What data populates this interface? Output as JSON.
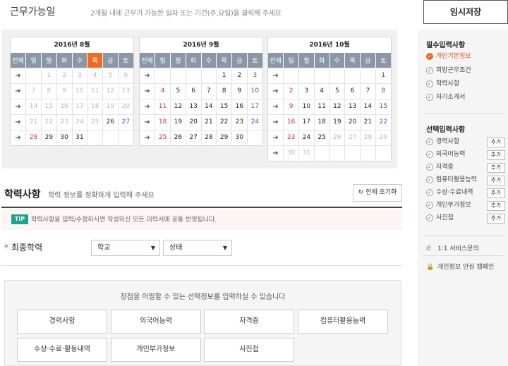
{
  "work_days": {
    "title": "근무가능일",
    "guide": "2개월 내에 근무가 가능한 일자 또는 기간(주,요일)을 클릭해 주세요"
  },
  "calendar": {
    "week_col": "전체",
    "weekdays": [
      "일",
      "월",
      "화",
      "수",
      "목",
      "금",
      "토"
    ],
    "months": [
      {
        "title": "2016년 8월",
        "rows": [
          [
            "",
            "1",
            "2",
            "3",
            "4",
            "5",
            "6"
          ],
          [
            "7",
            "8",
            "9",
            "10",
            "11",
            "12",
            "13"
          ],
          [
            "14",
            "15",
            "16",
            "17",
            "18",
            "19",
            "20"
          ],
          [
            "21",
            "22",
            "23",
            "24",
            "25",
            "26",
            "27"
          ],
          [
            "28",
            "29",
            "30",
            "31",
            "",
            "",
            ""
          ]
        ]
      },
      {
        "title": "2016년 9월",
        "rows": [
          [
            "",
            "",
            "",
            "",
            "1",
            "2",
            "3"
          ],
          [
            "4",
            "5",
            "6",
            "7",
            "8",
            "9",
            "10"
          ],
          [
            "11",
            "12",
            "13",
            "14",
            "15",
            "16",
            "17"
          ],
          [
            "18",
            "19",
            "20",
            "21",
            "22",
            "23",
            "24"
          ],
          [
            "25",
            "26",
            "27",
            "28",
            "29",
            "30",
            ""
          ]
        ]
      },
      {
        "title": "2016년 10월",
        "rows": [
          [
            "",
            "",
            "",
            "",
            "",
            "",
            "1"
          ],
          [
            "2",
            "3",
            "4",
            "5",
            "6",
            "7",
            "8"
          ],
          [
            "9",
            "10",
            "11",
            "12",
            "13",
            "14",
            "15"
          ],
          [
            "16",
            "17",
            "18",
            "19",
            "20",
            "21",
            "22"
          ],
          [
            "23",
            "24",
            "25",
            "26",
            "27",
            "28",
            "29"
          ],
          [
            "30",
            "31",
            "",
            "",
            "",
            "",
            ""
          ]
        ]
      }
    ],
    "colors": {
      "header": "#8a97a6",
      "today_col": "#f06a1f",
      "sunday": "#d6323c",
      "saturday": "#2a66b5",
      "disabled": "#b9b9b9"
    }
  },
  "education": {
    "title": "학력사항",
    "desc": "학력 정보를 정확하게 입력해 주세요",
    "reset_label": "전체 초기화",
    "tip_badge": "TIP",
    "tip_text": "학력사항을 입력/수정하시면 작성하신 모든 이력서에 공통 반영됩니다.",
    "final_label": "최종학력",
    "required_mark": "*",
    "school_select": "학교",
    "status_select": "상태"
  },
  "optional": {
    "guide": "장점을 어필할 수 있는 선택정보를 입력하실 수 있습니다",
    "buttons": [
      "경력사항",
      "외국어능력",
      "자격증",
      "컴퓨터활용능력",
      "수상·수료·활동내역",
      "개인부가정보",
      "사진첩"
    ]
  },
  "sidebar": {
    "save_label": "임시저장",
    "required_title": "필수입력사항",
    "required_items": [
      "개인기본정보",
      "희망근무조건",
      "학력사항",
      "자기소개서"
    ],
    "optional_title": "선택입력사항",
    "optional_items": [
      "경력사항",
      "외국어능력",
      "자격증",
      "컴퓨터활용능력",
      "수상·수료내역",
      "개인부가정보",
      "사진첩"
    ],
    "add_label": "추가",
    "service_label": "1:1 서비스문의",
    "privacy_label": "개인정보 안심 캠페인"
  },
  "accent_color": "#f06a1f"
}
